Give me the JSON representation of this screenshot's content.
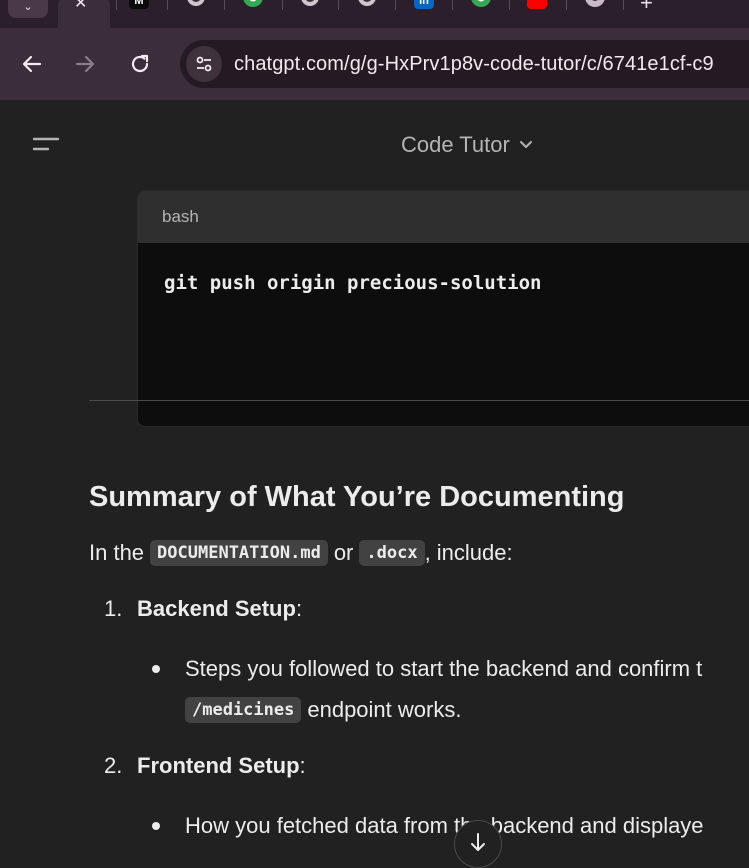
{
  "browser": {
    "url": "chatgpt.com/g/g-HxPrv1p8v-code-tutor/c/6741e1cf-c9",
    "tab_icons": [
      "tab-dropdown-icon",
      "close-icon",
      "medium-icon",
      "chrome-icon",
      "linkedin-icon",
      "youtube-icon",
      "new-tab-icon"
    ],
    "tab_close_glyph": "✕",
    "tab_dropdown_glyph": "⌄",
    "new_tab_glyph": "+",
    "medium_glyph": "M",
    "linkedin_glyph": "in",
    "accent_colors": {
      "chrome_bg": "#3b2d39",
      "page_bg": "#212121",
      "code_bg": "#0d0d0d",
      "linkedin": "#0a66c2",
      "youtube": "#ff0000"
    }
  },
  "header": {
    "model_name": "Code Tutor",
    "chevron_glyph": "⌄"
  },
  "code_block": {
    "language": "bash",
    "code": "git push origin precious-solution"
  },
  "content": {
    "heading": "Summary of What You’re Documenting",
    "intro": {
      "before": "In the",
      "code1": "DOCUMENTATION.md",
      "middle": "or",
      "code2": ".docx",
      "after": ", include:"
    },
    "list": [
      {
        "number": "1.",
        "title": "Backend Setup",
        "suffix": ":",
        "bullet_line1": "Steps you followed to start the backend and confirm t",
        "bullet_code": "/medicines",
        "bullet_line2": "endpoint works."
      },
      {
        "number": "2.",
        "title": "Frontend Setup",
        "suffix": ":",
        "bullet_line1": "How you fetched data from the backend and displaye"
      }
    ]
  }
}
